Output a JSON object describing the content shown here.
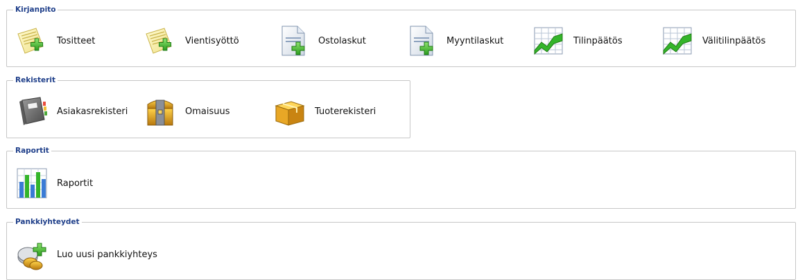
{
  "sections": {
    "kirjanpito": {
      "title": "Kirjanpito",
      "items": [
        {
          "label": "Tositteet",
          "icon": "note-add-icon"
        },
        {
          "label": "Vientisyöttö",
          "icon": "note-add-icon"
        },
        {
          "label": "Ostolaskut",
          "icon": "document-add-icon"
        },
        {
          "label": "Myyntilaskut",
          "icon": "document-add-icon"
        },
        {
          "label": "Tilinpäätös",
          "icon": "chart-icon"
        },
        {
          "label": "Välitilinpäätös",
          "icon": "chart-icon"
        }
      ]
    },
    "rekisterit": {
      "title": "Rekisterit",
      "items": [
        {
          "label": "Asiakasrekisteri",
          "icon": "address-book-icon"
        },
        {
          "label": "Omaisuus",
          "icon": "treasure-chest-icon"
        },
        {
          "label": "Tuoterekisteri",
          "icon": "package-box-icon"
        }
      ]
    },
    "raportit": {
      "title": "Raportit",
      "items": [
        {
          "label": "Raportit",
          "icon": "bar-chart-icon"
        }
      ]
    },
    "pankkiyhteydet": {
      "title": "Pankkiyhteydet",
      "items": [
        {
          "label": "Luo uusi pankkiyhteys",
          "icon": "coins-add-icon"
        }
      ]
    }
  },
  "colors": {
    "legend": "#1f3f8a",
    "border": "#c6c6c6",
    "plus": "#3db82e"
  }
}
